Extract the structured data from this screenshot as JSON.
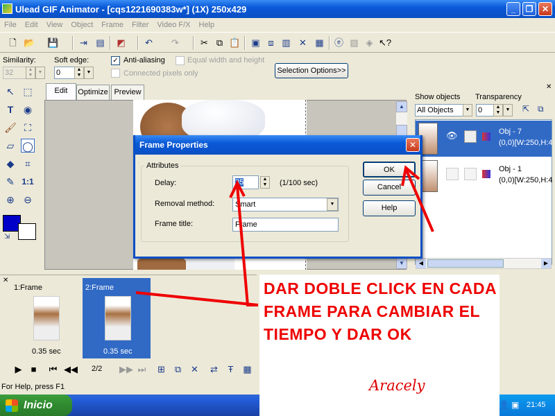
{
  "window": {
    "title": "Ulead GIF Animator - [cqs1221690383w*] (1X) 250x429"
  },
  "menu": [
    "File",
    "Edit",
    "View",
    "Object",
    "Frame",
    "Filter",
    "Video F/X",
    "Help"
  ],
  "options": {
    "similarity_label": "Similarity:",
    "similarity_value": "32",
    "soft_edge_label": "Soft edge:",
    "soft_edge_value": "0",
    "anti_aliasing_label": "Anti-aliasing",
    "equal_wh_label": "Equal width and height",
    "connected_label": "Connected pixels only",
    "selection_options": "Selection Options>>"
  },
  "tabs": [
    "Edit",
    "Optimize",
    "Preview"
  ],
  "right_panel": {
    "show_objects_label": "Show objects",
    "show_objects_value": "All Objects",
    "transparency_label": "Transparency",
    "transparency_value": "0",
    "objects": [
      {
        "name": "Obj - 7",
        "info": "(0,0)[W:250,H:4"
      },
      {
        "name": "Obj - 1",
        "info": "(0,0)[W:250,H:4"
      }
    ]
  },
  "dialog": {
    "title": "Frame Properties",
    "group": "Attributes",
    "delay_label": "Delay:",
    "delay_value": "35",
    "delay_unit": "(1/100 sec)",
    "removal_label": "Removal method:",
    "removal_value": "Smart",
    "frame_title_label": "Frame title:",
    "frame_title_value": "Frame",
    "ok": "OK",
    "cancel": "Cancel",
    "help": "Help"
  },
  "frames": [
    {
      "label": "1:Frame",
      "time": "0.35 sec"
    },
    {
      "label": "2:Frame",
      "time": "0.35 sec"
    }
  ],
  "playbar": {
    "counter": "2/2"
  },
  "status": "For Help, press F1",
  "taskbar": {
    "start": "Inicio",
    "clock": "21:45"
  },
  "annotation": {
    "text": "DAR DOBLE CLICK EN CADA FRAME PARA CAMBIAR EL TIEMPO Y DAR OK",
    "signature": "Aracely"
  },
  "colors": {
    "titlebar": "#0a5ad8",
    "annotation": "#e00000",
    "selected_frame": "#316ac5"
  }
}
